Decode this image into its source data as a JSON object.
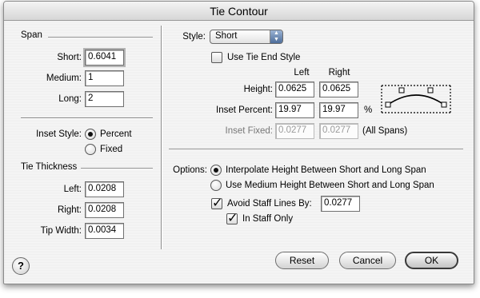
{
  "window": {
    "title": "Tie Contour"
  },
  "span": {
    "title": "Span",
    "short_label": "Short:",
    "short_value": "0.6041",
    "medium_label": "Medium:",
    "medium_value": "1",
    "long_label": "Long:",
    "long_value": "2"
  },
  "inset_style": {
    "label": "Inset Style:",
    "percent_label": "Percent",
    "fixed_label": "Fixed",
    "selected": "Percent"
  },
  "tie_thickness": {
    "title": "Tie Thickness",
    "left_label": "Left:",
    "left_value": "0.0208",
    "right_label": "Right:",
    "right_value": "0.0208",
    "tip_label": "Tip Width:",
    "tip_value": "0.0034"
  },
  "style": {
    "label": "Style:",
    "value": "Short",
    "use_tie_end_label": "Use Tie End Style",
    "use_tie_end_checked": false,
    "left_header": "Left",
    "right_header": "Right",
    "height_label": "Height:",
    "height_left": "0.0625",
    "height_right": "0.0625",
    "inset_percent_label": "Inset Percent:",
    "inset_percent_left": "19.97",
    "inset_percent_right": "19.97",
    "percent_unit": "%",
    "inset_fixed_label": "Inset Fixed:",
    "inset_fixed_left": "0.0277",
    "inset_fixed_right": "0.0277",
    "all_spans": "(All Spans)"
  },
  "options": {
    "label": "Options:",
    "interpolate_label": "Interpolate Height Between Short and Long Span",
    "medium_label": "Use Medium Height Between Short and Long Span",
    "selected": "interpolate",
    "avoid_label": "Avoid Staff Lines By:",
    "avoid_checked": true,
    "avoid_value": "0.0277",
    "in_staff_label": "In Staff Only",
    "in_staff_checked": true
  },
  "buttons": {
    "help": "?",
    "reset": "Reset",
    "cancel": "Cancel",
    "ok": "OK"
  },
  "icons": {
    "popup_arrows": "up-down-arrows-icon",
    "preview": "tie-curve-preview-icon",
    "help": "help-icon"
  }
}
